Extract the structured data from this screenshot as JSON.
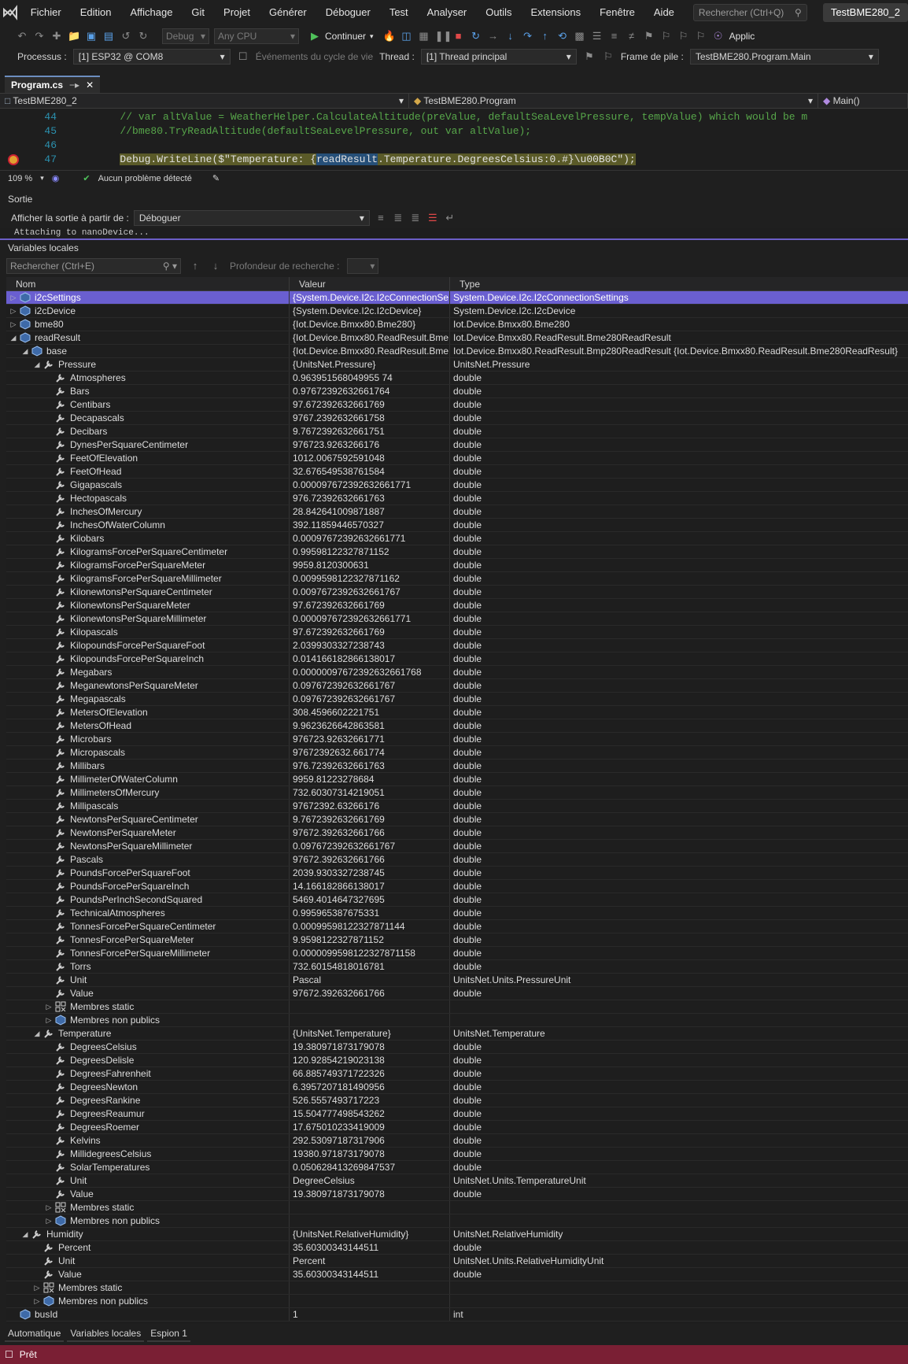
{
  "menu": {
    "items": [
      "Fichier",
      "Edition",
      "Affichage",
      "Git",
      "Projet",
      "Générer",
      "Déboguer",
      "Test",
      "Analyser",
      "Outils",
      "Extensions",
      "Fenêtre",
      "Aide"
    ],
    "search_placeholder": "Rechercher (Ctrl+Q)",
    "project_badge": "TestBME280_2"
  },
  "toolbar": {
    "config": "Debug",
    "platform": "Any CPU",
    "continue_label": "Continuer",
    "app_label": "Applic"
  },
  "debug_bar": {
    "process_label": "Processus :",
    "process_value": "[1] ESP32 @ COM8",
    "lifecycle_label": "Événements du cycle de vie",
    "thread_label": "Thread :",
    "thread_value": "[1] Thread principal",
    "frame_label": "Frame de pile :",
    "frame_value": "TestBME280.Program.Main"
  },
  "editor": {
    "tab_label": "Program.cs",
    "nav_project": "TestBME280_2",
    "nav_class": "TestBME280.Program",
    "nav_member": "Main()",
    "lines": [
      {
        "num": "44",
        "code": "        // var altValue = WeatherHelper.CalculateAltitude(preValue, defaultSeaLevelPressure, tempValue) which would be m"
      },
      {
        "num": "45",
        "code": "        //bme80.TryReadAltitude(defaultSeaLevelPressure, out var altValue);"
      },
      {
        "num": "46",
        "code": ""
      },
      {
        "num": "47",
        "pre": "        ",
        "hl_a": "Debug.WriteLine($\"Temperature: {",
        "hl_b": "readResult",
        "hl_c": ".Temperature.DegreesCelsius:0.#}\\u00B0C\");"
      }
    ],
    "zoom": "109 %",
    "issues": "Aucun problème détecté"
  },
  "output": {
    "title": "Sortie",
    "source_label": "Afficher la sortie à partir de :",
    "source_value": "Déboguer",
    "text": "Attaching to nanoDevice..."
  },
  "locals": {
    "title": "Variables locales",
    "search_placeholder": "Rechercher (Ctrl+E)",
    "depth_label": "Profondeur de recherche :",
    "columns": [
      "Nom",
      "Valeur",
      "Type"
    ],
    "rows": [
      {
        "d": 0,
        "x": "c",
        "i": "obj",
        "n": "i2cSettings",
        "v": "{System.Device.I2c.I2cConnectionSe...",
        "t": "System.Device.I2c.I2cConnectionSettings",
        "sel": true
      },
      {
        "d": 0,
        "x": "c",
        "i": "obj",
        "n": "i2cDevice",
        "v": "{System.Device.I2c.I2cDevice}",
        "t": "System.Device.I2c.I2cDevice"
      },
      {
        "d": 0,
        "x": "c",
        "i": "obj",
        "n": "bme80",
        "v": "{Iot.Device.Bmxx80.Bme280}",
        "t": "Iot.Device.Bmxx80.Bme280"
      },
      {
        "d": 0,
        "x": "e",
        "i": "obj",
        "n": "readResult",
        "v": "{Iot.Device.Bmxx80.ReadResult.Bme...",
        "t": "Iot.Device.Bmxx80.ReadResult.Bme280ReadResult"
      },
      {
        "d": 1,
        "x": "e",
        "i": "obj",
        "n": "base",
        "v": "{Iot.Device.Bmxx80.ReadResult.Bme...",
        "t": "Iot.Device.Bmxx80.ReadResult.Bmp280ReadResult {Iot.Device.Bmxx80.ReadResult.Bme280ReadResult}"
      },
      {
        "d": 2,
        "x": "e",
        "i": "prop",
        "n": "Pressure",
        "v": "{UnitsNet.Pressure}",
        "t": "UnitsNet.Pressure"
      },
      {
        "d": 3,
        "x": "",
        "i": "prop",
        "n": "Atmospheres",
        "v": "0.963951568049955 74",
        "t": "double"
      },
      {
        "d": 3,
        "x": "",
        "i": "prop",
        "n": "Bars",
        "v": "0.97672392632661764",
        "t": "double"
      },
      {
        "d": 3,
        "x": "",
        "i": "prop",
        "n": "Centibars",
        "v": "97.672392632661769",
        "t": "double"
      },
      {
        "d": 3,
        "x": "",
        "i": "prop",
        "n": "Decapascals",
        "v": "9767.2392632661758",
        "t": "double"
      },
      {
        "d": 3,
        "x": "",
        "i": "prop",
        "n": "Decibars",
        "v": "9.7672392632661751",
        "t": "double"
      },
      {
        "d": 3,
        "x": "",
        "i": "prop",
        "n": "DynesPerSquareCentimeter",
        "v": "976723.9263266176",
        "t": "double"
      },
      {
        "d": 3,
        "x": "",
        "i": "prop",
        "n": "FeetOfElevation",
        "v": "1012.0067592591048",
        "t": "double"
      },
      {
        "d": 3,
        "x": "",
        "i": "prop",
        "n": "FeetOfHead",
        "v": "32.676549538761584",
        "t": "double"
      },
      {
        "d": 3,
        "x": "",
        "i": "prop",
        "n": "Gigapascals",
        "v": "0.000097672392632661771",
        "t": "double"
      },
      {
        "d": 3,
        "x": "",
        "i": "prop",
        "n": "Hectopascals",
        "v": "976.72392632661763",
        "t": "double"
      },
      {
        "d": 3,
        "x": "",
        "i": "prop",
        "n": "InchesOfMercury",
        "v": "28.842641009871887",
        "t": "double"
      },
      {
        "d": 3,
        "x": "",
        "i": "prop",
        "n": "InchesOfWaterColumn",
        "v": "392.11859446570327",
        "t": "double"
      },
      {
        "d": 3,
        "x": "",
        "i": "prop",
        "n": "Kilobars",
        "v": "0.00097672392632661771",
        "t": "double"
      },
      {
        "d": 3,
        "x": "",
        "i": "prop",
        "n": "KilogramsForcePerSquareCentimeter",
        "v": "0.99598122327871152",
        "t": "double"
      },
      {
        "d": 3,
        "x": "",
        "i": "prop",
        "n": "KilogramsForcePerSquareMeter",
        "v": "9959.8120300631",
        "t": "double"
      },
      {
        "d": 3,
        "x": "",
        "i": "prop",
        "n": "KilogramsForcePerSquareMillimeter",
        "v": "0.0099598122327871162",
        "t": "double"
      },
      {
        "d": 3,
        "x": "",
        "i": "prop",
        "n": "KilonewtonsPerSquareCentimeter",
        "v": "0.0097672392632661767",
        "t": "double"
      },
      {
        "d": 3,
        "x": "",
        "i": "prop",
        "n": "KilonewtonsPerSquareMeter",
        "v": "97.672392632661769",
        "t": "double"
      },
      {
        "d": 3,
        "x": "",
        "i": "prop",
        "n": "KilonewtonsPerSquareMillimeter",
        "v": "0.000097672392632661771",
        "t": "double"
      },
      {
        "d": 3,
        "x": "",
        "i": "prop",
        "n": "Kilopascals",
        "v": "97.672392632661769",
        "t": "double"
      },
      {
        "d": 3,
        "x": "",
        "i": "prop",
        "n": "KilopoundsForcePerSquareFoot",
        "v": "2.0399303327238743",
        "t": "double"
      },
      {
        "d": 3,
        "x": "",
        "i": "prop",
        "n": "KilopoundsForcePerSquareInch",
        "v": "0.014166182866138017",
        "t": "double"
      },
      {
        "d": 3,
        "x": "",
        "i": "prop",
        "n": "Megabars",
        "v": "0.00000097672392632661768",
        "t": "double"
      },
      {
        "d": 3,
        "x": "",
        "i": "prop",
        "n": "MeganewtonsPerSquareMeter",
        "v": "0.097672392632661767",
        "t": "double"
      },
      {
        "d": 3,
        "x": "",
        "i": "prop",
        "n": "Megapascals",
        "v": "0.097672392632661767",
        "t": "double"
      },
      {
        "d": 3,
        "x": "",
        "i": "prop",
        "n": "MetersOfElevation",
        "v": "308.4596602221751",
        "t": "double"
      },
      {
        "d": 3,
        "x": "",
        "i": "prop",
        "n": "MetersOfHead",
        "v": "9.9623626642863581",
        "t": "double"
      },
      {
        "d": 3,
        "x": "",
        "i": "prop",
        "n": "Microbars",
        "v": "976723.92632661771",
        "t": "double"
      },
      {
        "d": 3,
        "x": "",
        "i": "prop",
        "n": "Micropascals",
        "v": "97672392632.661774",
        "t": "double"
      },
      {
        "d": 3,
        "x": "",
        "i": "prop",
        "n": "Millibars",
        "v": "976.72392632661763",
        "t": "double"
      },
      {
        "d": 3,
        "x": "",
        "i": "prop",
        "n": "MillimeterOfWaterColumn",
        "v": "9959.81223278684",
        "t": "double"
      },
      {
        "d": 3,
        "x": "",
        "i": "prop",
        "n": "MillimetersOfMercury",
        "v": "732.60307314219051",
        "t": "double"
      },
      {
        "d": 3,
        "x": "",
        "i": "prop",
        "n": "Millipascals",
        "v": "97672392.63266176",
        "t": "double"
      },
      {
        "d": 3,
        "x": "",
        "i": "prop",
        "n": "NewtonsPerSquareCentimeter",
        "v": "9.7672392632661769",
        "t": "double"
      },
      {
        "d": 3,
        "x": "",
        "i": "prop",
        "n": "NewtonsPerSquareMeter",
        "v": "97672.392632661766",
        "t": "double"
      },
      {
        "d": 3,
        "x": "",
        "i": "prop",
        "n": "NewtonsPerSquareMillimeter",
        "v": "0.097672392632661767",
        "t": "double"
      },
      {
        "d": 3,
        "x": "",
        "i": "prop",
        "n": "Pascals",
        "v": "97672.392632661766",
        "t": "double"
      },
      {
        "d": 3,
        "x": "",
        "i": "prop",
        "n": "PoundsForcePerSquareFoot",
        "v": "2039.9303327238745",
        "t": "double"
      },
      {
        "d": 3,
        "x": "",
        "i": "prop",
        "n": "PoundsForcePerSquareInch",
        "v": "14.166182866138017",
        "t": "double"
      },
      {
        "d": 3,
        "x": "",
        "i": "prop",
        "n": "PoundsPerInchSecondSquared",
        "v": "5469.4014647327695",
        "t": "double"
      },
      {
        "d": 3,
        "x": "",
        "i": "prop",
        "n": "TechnicalAtmospheres",
        "v": "0.995965387675331",
        "t": "double"
      },
      {
        "d": 3,
        "x": "",
        "i": "prop",
        "n": "TonnesForcePerSquareCentimeter",
        "v": "0.00099598122327871144",
        "t": "double"
      },
      {
        "d": 3,
        "x": "",
        "i": "prop",
        "n": "TonnesForcePerSquareMeter",
        "v": "9.9598122327871152",
        "t": "double"
      },
      {
        "d": 3,
        "x": "",
        "i": "prop",
        "n": "TonnesForcePerSquareMillimeter",
        "v": "0.0000099598122327871158",
        "t": "double"
      },
      {
        "d": 3,
        "x": "",
        "i": "prop",
        "n": "Torrs",
        "v": "732.60154818016781",
        "t": "double"
      },
      {
        "d": 3,
        "x": "",
        "i": "prop",
        "n": "Unit",
        "v": "Pascal",
        "t": "UnitsNet.Units.PressureUnit"
      },
      {
        "d": 3,
        "x": "",
        "i": "prop",
        "n": "Value",
        "v": "97672.392632661766",
        "t": "double"
      },
      {
        "d": 3,
        "x": "c",
        "i": "static",
        "n": "Membres static",
        "v": "",
        "t": ""
      },
      {
        "d": 3,
        "x": "c",
        "i": "obj",
        "n": "Membres non publics",
        "v": "",
        "t": ""
      },
      {
        "d": 2,
        "x": "e",
        "i": "prop",
        "n": "Temperature",
        "v": "{UnitsNet.Temperature}",
        "t": "UnitsNet.Temperature"
      },
      {
        "d": 3,
        "x": "",
        "i": "prop",
        "n": "DegreesCelsius",
        "v": "19.380971873179078",
        "t": "double"
      },
      {
        "d": 3,
        "x": "",
        "i": "prop",
        "n": "DegreesDelisle",
        "v": "120.92854219023138",
        "t": "double"
      },
      {
        "d": 3,
        "x": "",
        "i": "prop",
        "n": "DegreesFahrenheit",
        "v": "66.885749371722326",
        "t": "double"
      },
      {
        "d": 3,
        "x": "",
        "i": "prop",
        "n": "DegreesNewton",
        "v": "6.3957207181490956",
        "t": "double"
      },
      {
        "d": 3,
        "x": "",
        "i": "prop",
        "n": "DegreesRankine",
        "v": "526.5557493717223",
        "t": "double"
      },
      {
        "d": 3,
        "x": "",
        "i": "prop",
        "n": "DegreesReaumur",
        "v": "15.504777498543262",
        "t": "double"
      },
      {
        "d": 3,
        "x": "",
        "i": "prop",
        "n": "DegreesRoemer",
        "v": "17.675010233419009",
        "t": "double"
      },
      {
        "d": 3,
        "x": "",
        "i": "prop",
        "n": "Kelvins",
        "v": "292.53097187317906",
        "t": "double"
      },
      {
        "d": 3,
        "x": "",
        "i": "prop",
        "n": "MillidegreesCelsius",
        "v": "19380.971873179078",
        "t": "double"
      },
      {
        "d": 3,
        "x": "",
        "i": "prop",
        "n": "SolarTemperatures",
        "v": "0.050628413269847537",
        "t": "double"
      },
      {
        "d": 3,
        "x": "",
        "i": "prop",
        "n": "Unit",
        "v": "DegreeCelsius",
        "t": "UnitsNet.Units.TemperatureUnit"
      },
      {
        "d": 3,
        "x": "",
        "i": "prop",
        "n": "Value",
        "v": "19.380971873179078",
        "t": "double"
      },
      {
        "d": 3,
        "x": "c",
        "i": "static",
        "n": "Membres static",
        "v": "",
        "t": ""
      },
      {
        "d": 3,
        "x": "c",
        "i": "obj",
        "n": "Membres non publics",
        "v": "",
        "t": ""
      },
      {
        "d": 1,
        "x": "e",
        "i": "prop",
        "n": "Humidity",
        "v": "{UnitsNet.RelativeHumidity}",
        "t": "UnitsNet.RelativeHumidity"
      },
      {
        "d": 2,
        "x": "",
        "i": "prop",
        "n": "Percent",
        "v": "35.60300343144511",
        "t": "double"
      },
      {
        "d": 2,
        "x": "",
        "i": "prop",
        "n": "Unit",
        "v": "Percent",
        "t": "UnitsNet.Units.RelativeHumidityUnit"
      },
      {
        "d": 2,
        "x": "",
        "i": "prop",
        "n": "Value",
        "v": "35.60300343144511",
        "t": "double"
      },
      {
        "d": 2,
        "x": "c",
        "i": "static",
        "n": "Membres static",
        "v": "",
        "t": ""
      },
      {
        "d": 2,
        "x": "c",
        "i": "obj",
        "n": "Membres non publics",
        "v": "",
        "t": ""
      },
      {
        "d": 0,
        "x": "",
        "i": "obj",
        "n": "busId",
        "v": "1",
        "t": "int"
      }
    ]
  },
  "bottom_tabs": [
    "Automatique",
    "Variables locales",
    "Espion 1"
  ],
  "status": {
    "text": "Prêt"
  },
  "colors": {
    "accent": "#6a5fd0",
    "status_bg": "#7a1f34"
  }
}
